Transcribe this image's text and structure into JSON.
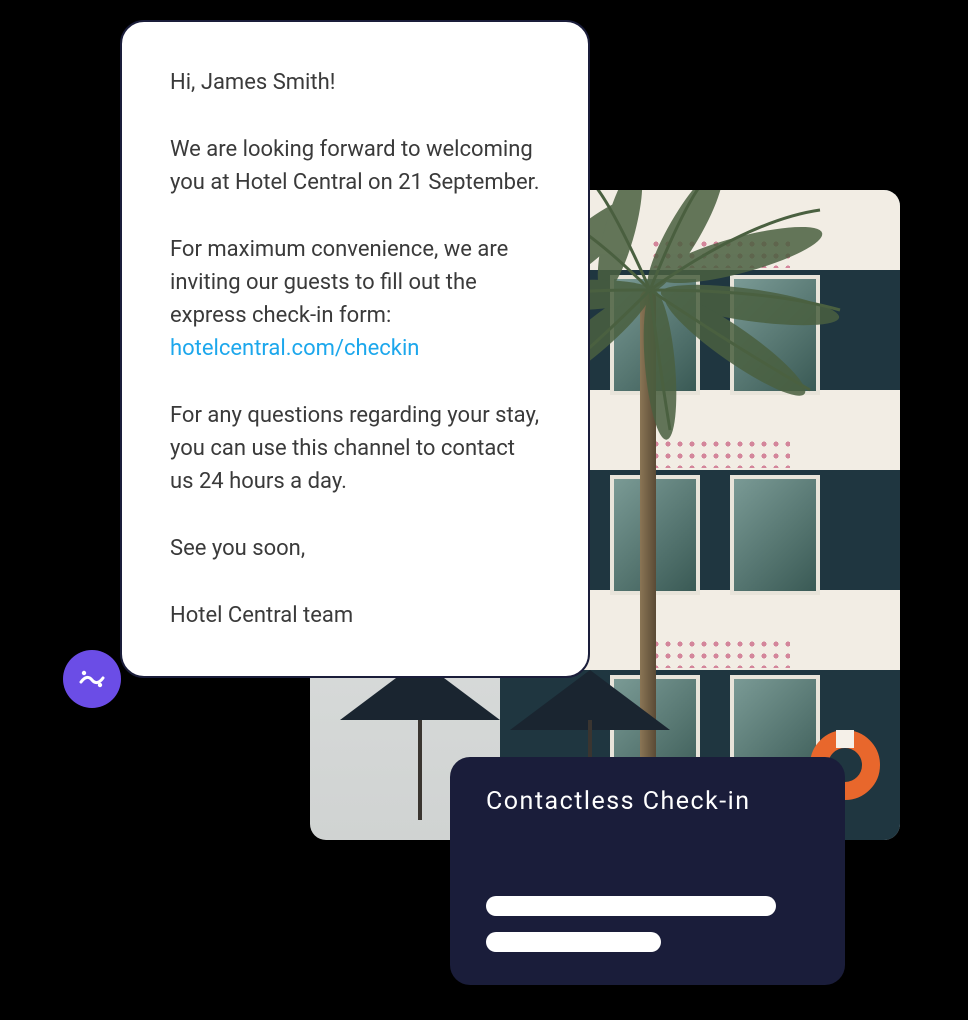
{
  "message": {
    "greeting": "Hi, James Smith!",
    "welcome_text_pre": "We are looking forward to welcoming you at Hotel Central on 21 September.",
    "convenience_text": "For maximum convenience, we are inviting our guests to fill out the express check-in form:",
    "checkin_link": "hotelcentral.com/checkin",
    "questions_text": "For any questions regarding your stay, you can use this channel to contact us 24 hours a day.",
    "closing": "See you soon,",
    "signature": "Hotel Central team"
  },
  "checkin_card": {
    "title": "Contactless Check-in"
  }
}
